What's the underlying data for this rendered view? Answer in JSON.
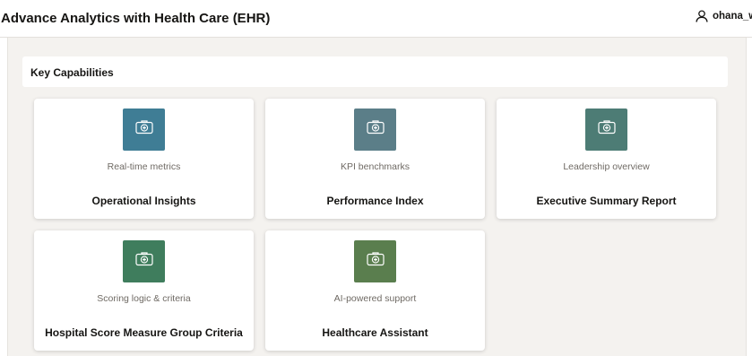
{
  "header": {
    "title": "Advance Analytics with Health Care (EHR)",
    "user": {
      "name": "ohana_w",
      "icon": "user-icon"
    }
  },
  "section": {
    "title": "Key Capabilities"
  },
  "cards": [
    {
      "subtitle": "Real-time metrics",
      "title": "Operational Insights",
      "icon": "medical-kit-icon",
      "color": "#3f7d95"
    },
    {
      "subtitle": "KPI benchmarks",
      "title": "Performance Index",
      "icon": "medical-kit-icon",
      "color": "#5b7e88"
    },
    {
      "subtitle": "Leadership overview",
      "title": "Executive Summary Report",
      "icon": "medical-kit-icon",
      "color": "#4d7c75"
    },
    {
      "subtitle": "Scoring logic & criteria",
      "title": "Hospital Score Measure Group Criteria",
      "icon": "medical-kit-icon",
      "color": "#3f7d5d"
    },
    {
      "subtitle": "AI-powered support",
      "title": "Healthcare Assistant",
      "icon": "medical-kit-icon",
      "color": "#5a7e4e"
    }
  ]
}
